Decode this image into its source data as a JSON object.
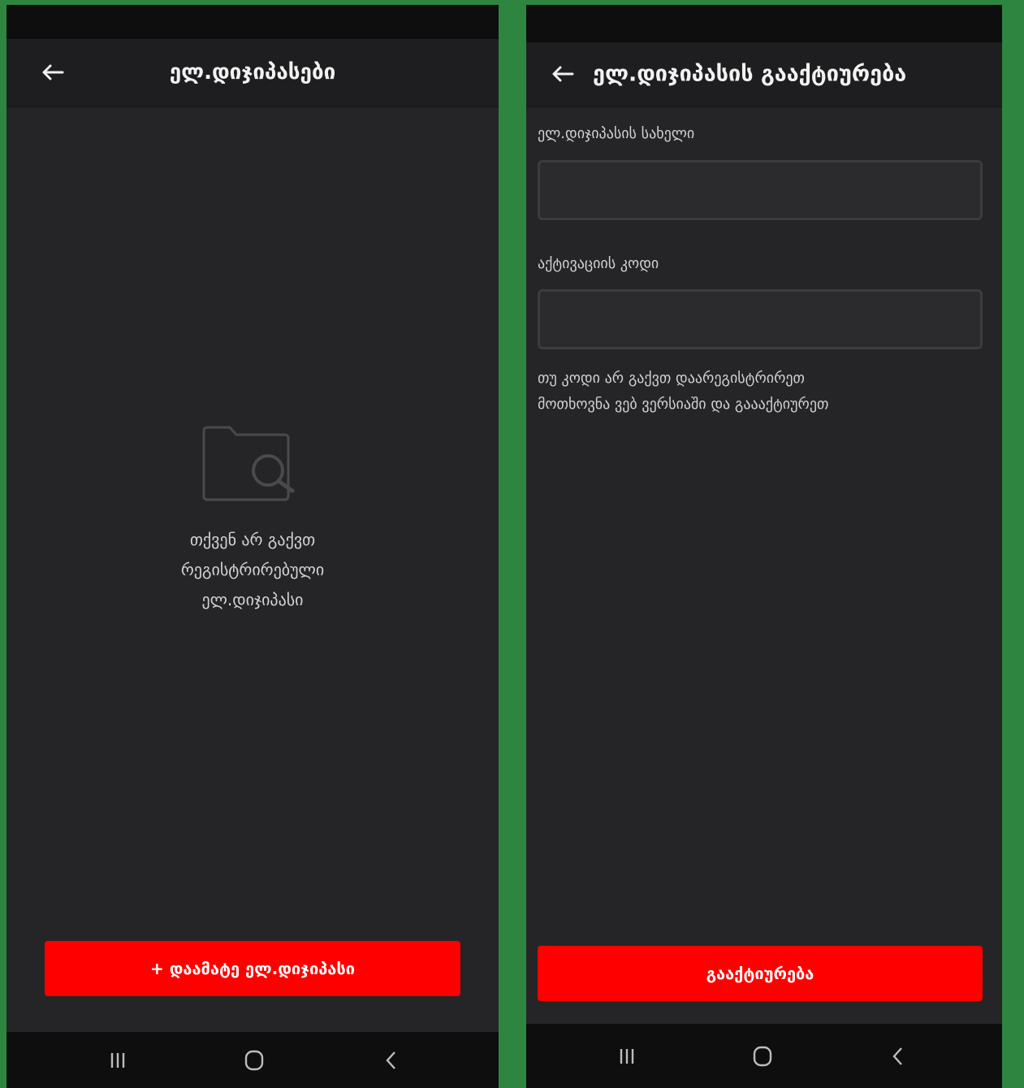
{
  "screen_list": {
    "title": "ელ.დიჯიპასები",
    "empty_state": {
      "icon": "folder-search-icon",
      "lines": [
        "თქვენ არ გაქვთ",
        "რეგისტრირებული",
        "ელ.დიჯიპასი"
      ]
    },
    "add_button_label": "+ დაამატე ელ.დიჯიპასი"
  },
  "screen_activate": {
    "title": "ელ.დიჯიპასის გააქტიურება",
    "name_field": {
      "label": "ელ.დიჯიპასის სახელი",
      "value": ""
    },
    "code_field": {
      "label": "აქტივაციის კოდი",
      "value": ""
    },
    "hint_lines": [
      "თუ კოდი არ გაქვთ დაარეგისტრირეთ",
      "მოთხოვნა ვებ ვერსიაში და გაააქტიურეთ"
    ],
    "activate_button_label": "გააქტიურება"
  },
  "icons": {
    "back": "arrow-left-icon",
    "recent_apps": "recent-apps-icon",
    "home": "home-icon",
    "system_back": "chevron-left-icon"
  },
  "colors": {
    "accent": "#ff0000",
    "screen_bg": "#252527",
    "app_bar_bg": "#1e1e20",
    "separator_bg": "#2e8540"
  }
}
